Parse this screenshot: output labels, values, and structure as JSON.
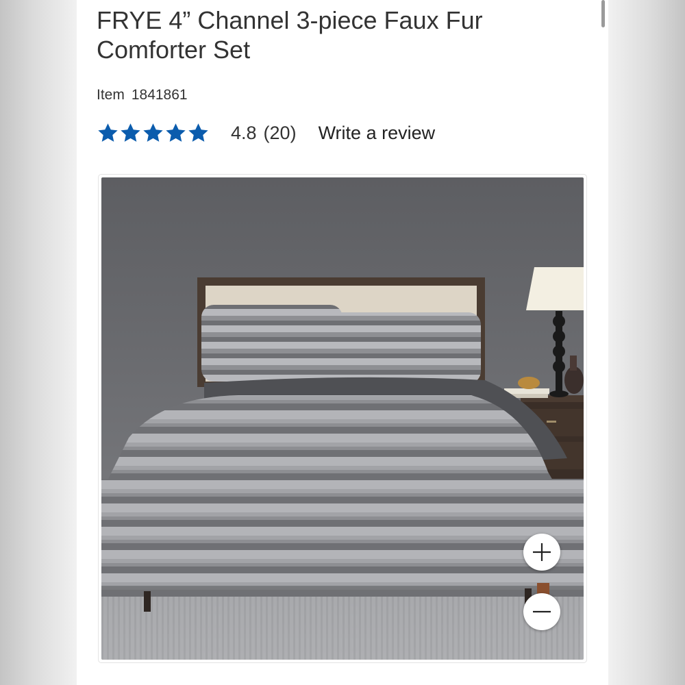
{
  "product": {
    "title": "FRYE 4” Channel 3-piece Faux Fur Comforter Set",
    "item_label": "Item",
    "item_number": "1841861"
  },
  "rating": {
    "stars": 5,
    "value": "4.8",
    "count": "(20)",
    "write_review_label": "Write a review",
    "star_color": "#0b5cad"
  },
  "image": {
    "alt": "FRYE 4” Channel 3-piece Faux Fur Comforter Set",
    "zoom_in_icon": "plus-icon",
    "zoom_out_icon": "minus-icon"
  }
}
